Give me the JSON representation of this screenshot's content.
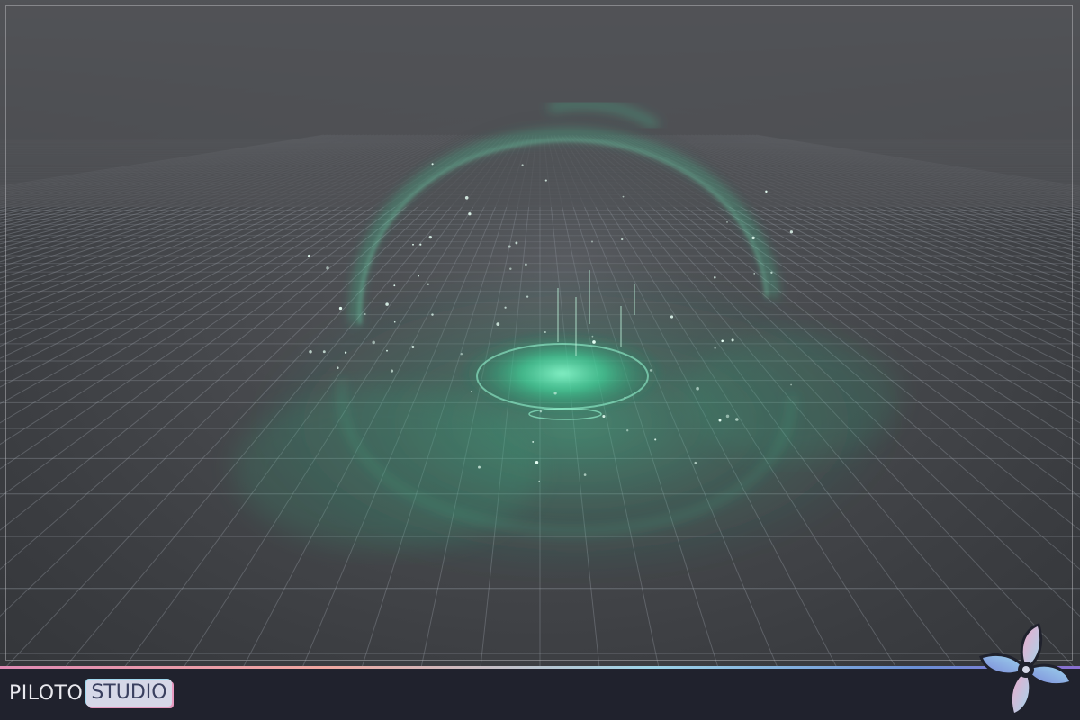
{
  "viewport": {
    "scene": "vfx-preview",
    "background_color": "#47494d",
    "grid_color": "#9aa0a8",
    "effect_color": "#3fd59a"
  },
  "branding": {
    "logo_word_1": "PILOTO",
    "logo_word_2": "STUDIO",
    "accent_pink": "#e79ac0",
    "accent_blue": "#9fd8ee"
  },
  "icons": {
    "fan": "fan-logo-icon"
  }
}
